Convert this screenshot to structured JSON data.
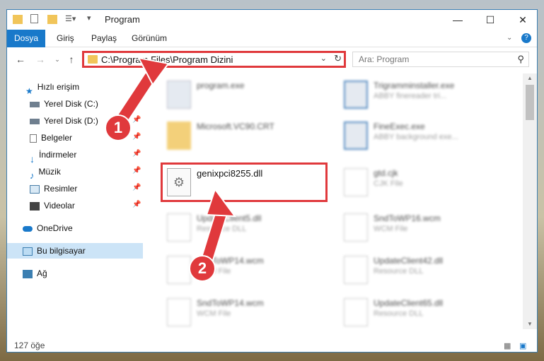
{
  "window": {
    "title": "Program"
  },
  "ribbon": {
    "tabs": [
      "Dosya",
      "Giriş",
      "Paylaş",
      "Görünüm"
    ]
  },
  "address": {
    "path": "C:\\Program Files\\Program Dizini"
  },
  "search": {
    "placeholder": "Ara: Program"
  },
  "sidebar": {
    "items": [
      {
        "label": "Hızlı erişim"
      },
      {
        "label": "Yerel Disk (C:)"
      },
      {
        "label": "Yerel Disk (D:)"
      },
      {
        "label": "Belgeler"
      },
      {
        "label": "İndirmeler"
      },
      {
        "label": "Müzik"
      },
      {
        "label": "Resimler"
      },
      {
        "label": "Videolar"
      },
      {
        "label": "OneDrive"
      },
      {
        "label": "Bu bilgisayar"
      },
      {
        "label": "Ağ"
      }
    ]
  },
  "files": [
    {
      "name": "program.exe",
      "type": ""
    },
    {
      "name": "Trigramminstaller.exe",
      "type": "ABBY finereader tri..."
    },
    {
      "name": "Microsoft.VC90.CRT",
      "type": ""
    },
    {
      "name": "FineExec.exe",
      "type": "ABBY background exe..."
    },
    {
      "name": "genixpci8255.dll",
      "type": ""
    },
    {
      "name": "gtd.cjk",
      "type": "CJK File"
    },
    {
      "name": "UpdateClient5.dll",
      "type": "Resource DLL"
    },
    {
      "name": "SndToWP16.wcm",
      "type": "WCM File"
    },
    {
      "name": "SndToWP14.wcm",
      "type": "WCM File"
    },
    {
      "name": "UpdateClient42.dll",
      "type": "Resource DLL"
    },
    {
      "name": "SndToWP14.wcm",
      "type": "WCM File"
    },
    {
      "name": "UpdateClient65.dll",
      "type": "Resource DLL"
    }
  ],
  "status": {
    "count": "127 öğe"
  },
  "annotations": {
    "badge1": "1",
    "badge2": "2"
  },
  "colors": {
    "accent": "#1979ca",
    "highlight": "#e0393c"
  }
}
